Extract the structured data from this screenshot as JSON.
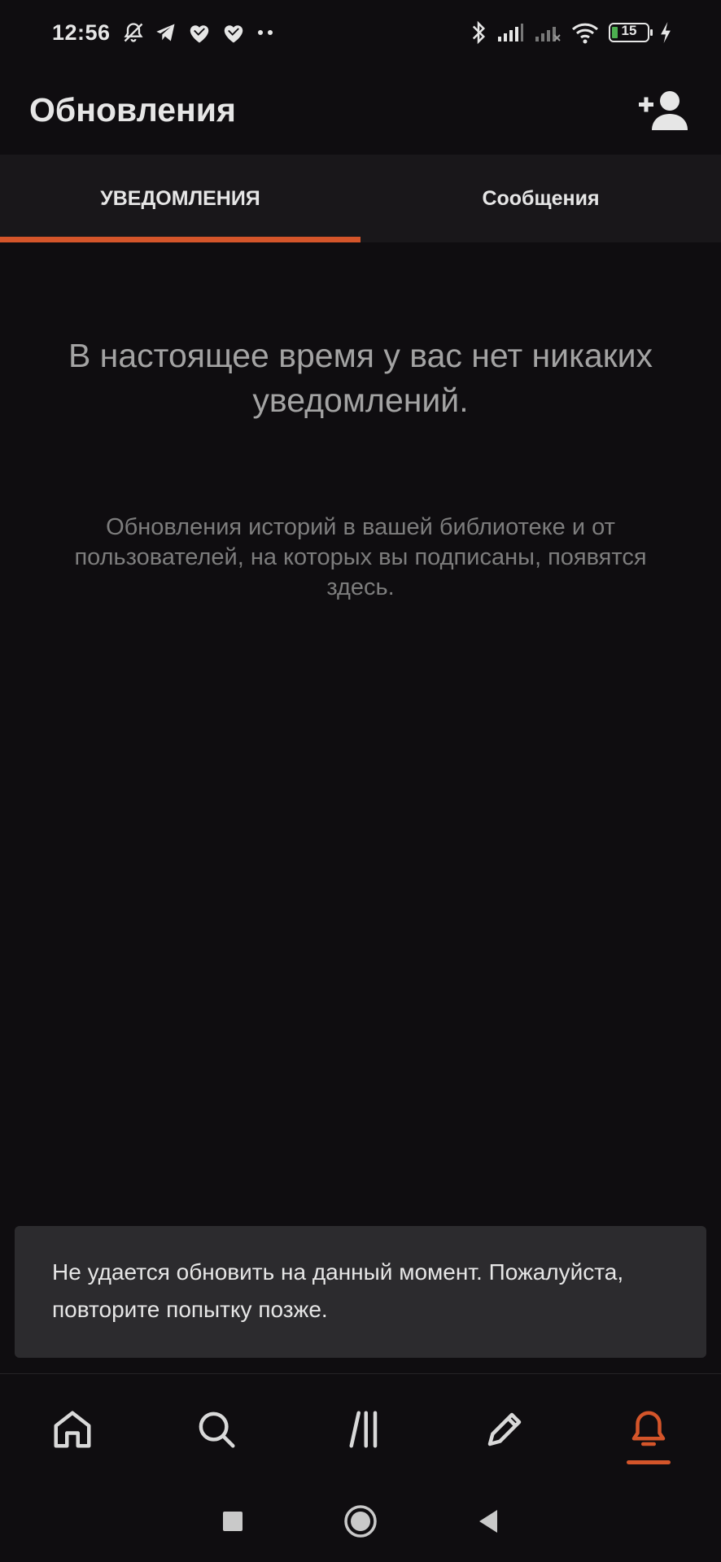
{
  "status_bar": {
    "time": "12:56",
    "battery_level": "15",
    "icons_left": [
      "bell-off-icon",
      "telegram-icon",
      "heart-icon",
      "heart-icon",
      "more-dots-icon"
    ],
    "icons_right": [
      "bluetooth-icon",
      "signal-icon",
      "signal-no-service-icon",
      "wifi-icon",
      "battery-icon",
      "charging-icon"
    ]
  },
  "header": {
    "title": "Обновления",
    "action_icon": "add-user-icon"
  },
  "tabs": [
    {
      "label": "УВЕДОМЛЕНИЯ",
      "active": true
    },
    {
      "label": "Сообщения",
      "active": false
    }
  ],
  "empty_state": {
    "title": "В настоящее время у вас нет никаких уведомлений.",
    "description": "Обновления историй в вашей библиотеке и от пользователей, на которых вы подписаны, появятся здесь."
  },
  "snackbar": {
    "message": "Не удается обновить на данный момент. Пожалуйста, повторите попытку позже."
  },
  "bottom_nav": {
    "items": [
      {
        "icon": "home-icon",
        "active": false
      },
      {
        "icon": "search-icon",
        "active": false
      },
      {
        "icon": "library-icon",
        "active": false
      },
      {
        "icon": "write-icon",
        "active": false
      },
      {
        "icon": "notifications-icon",
        "active": true
      }
    ]
  },
  "system_nav": [
    "recents-button",
    "home-button",
    "back-button"
  ],
  "colors": {
    "background": "#0f0d10",
    "accent": "#d4552a",
    "tab_bar": "#19171a",
    "snackbar": "#2c2b2e",
    "text_primary": "#e6e6e6",
    "text_secondary": "#7d7d7d"
  }
}
